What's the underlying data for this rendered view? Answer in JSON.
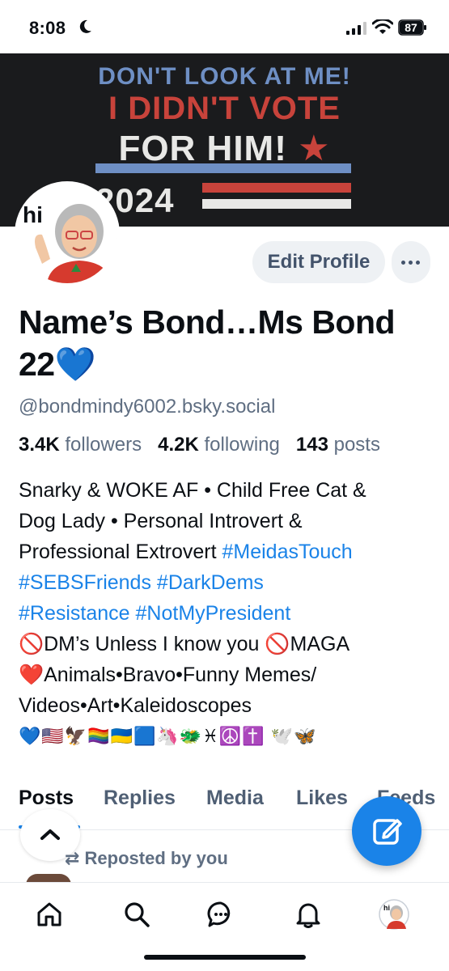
{
  "status_bar": {
    "time": "8:08",
    "battery": "87"
  },
  "banner": {
    "line1": "DON'T LOOK AT ME!",
    "line2": "I DIDN'T VOTE",
    "line3": "FOR HIM!",
    "line4": "2024",
    "colors": {
      "blue": "#6e8fc4",
      "red": "#c8433b",
      "white": "#e8e8e6"
    }
  },
  "profile": {
    "avatar_text": "hi",
    "display_name": "Name’s Bond…Ms Bond 22💙",
    "handle": "@bondmindy6002.bsky.social",
    "stats": {
      "followers_count": "3.4K",
      "followers_label": "followers",
      "following_count": "4.2K",
      "following_label": "following",
      "posts_count": "143",
      "posts_label": "posts"
    },
    "bio": {
      "line1": "Snarky & WOKE AF • Child Free Cat &",
      "line2": "Dog Lady • Personal Introvert &",
      "line3_text": "Professional Extrovert ",
      "tag1": "#MeidasTouch",
      "tag2": "#SEBSFriends",
      "tag3": "#DarkDems",
      "tag4": "#Resistance",
      "tag5": "#NotMyPresident",
      "line6": "🚫DM’s Unless I know you 🚫MAGA",
      "line7": "❤️Animals•Bravo•Funny Memes/",
      "line8": "Videos•Art•Kaleidoscopes",
      "emojis": "💙🇺🇸🦅🏳️‍🌈🇺🇦🟦🦄🐲♓☮️✝️ 🕊️🦋"
    },
    "edit_profile_label": "Edit Profile"
  },
  "tabs": [
    {
      "label": "Posts"
    },
    {
      "label": "Replies"
    },
    {
      "label": "Media"
    },
    {
      "label": "Likes"
    },
    {
      "label": "Feeds"
    }
  ],
  "feed": {
    "repost_label": "Reposted by you"
  },
  "nav": [
    "home-icon",
    "search-icon",
    "chat-icon",
    "bell-icon",
    "profile-avatar"
  ],
  "accent": "#1a83e8"
}
